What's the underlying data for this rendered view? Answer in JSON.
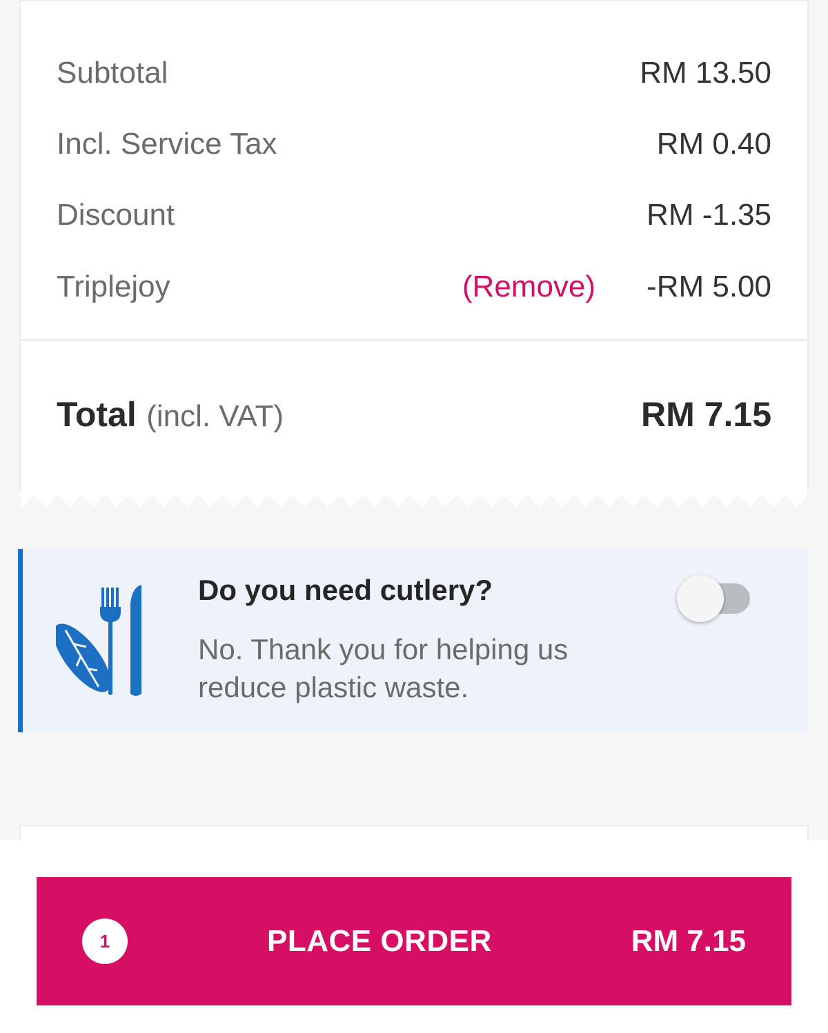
{
  "summary": {
    "rows": [
      {
        "label": "Subtotal",
        "value": "RM 13.50"
      },
      {
        "label": "Incl. Service Tax",
        "value": "RM 0.40"
      },
      {
        "label": "Discount",
        "value": "RM -1.35"
      },
      {
        "label": "Triplejoy",
        "action": "(Remove)",
        "value": "-RM 5.00"
      }
    ],
    "total": {
      "label": "Total",
      "note": "(incl. VAT)",
      "value": "RM 7.15"
    }
  },
  "cutlery": {
    "title": "Do you need cutlery?",
    "description": "No. Thank you for helping us reduce plastic waste.",
    "toggle_on": false,
    "icon": "leaf-cutlery-icon",
    "accent_color": "#1d6fc4"
  },
  "checkout": {
    "item_count": "1",
    "button_label": "PLACE ORDER",
    "price": "RM 7.15",
    "brand_color": "#d70f64"
  }
}
